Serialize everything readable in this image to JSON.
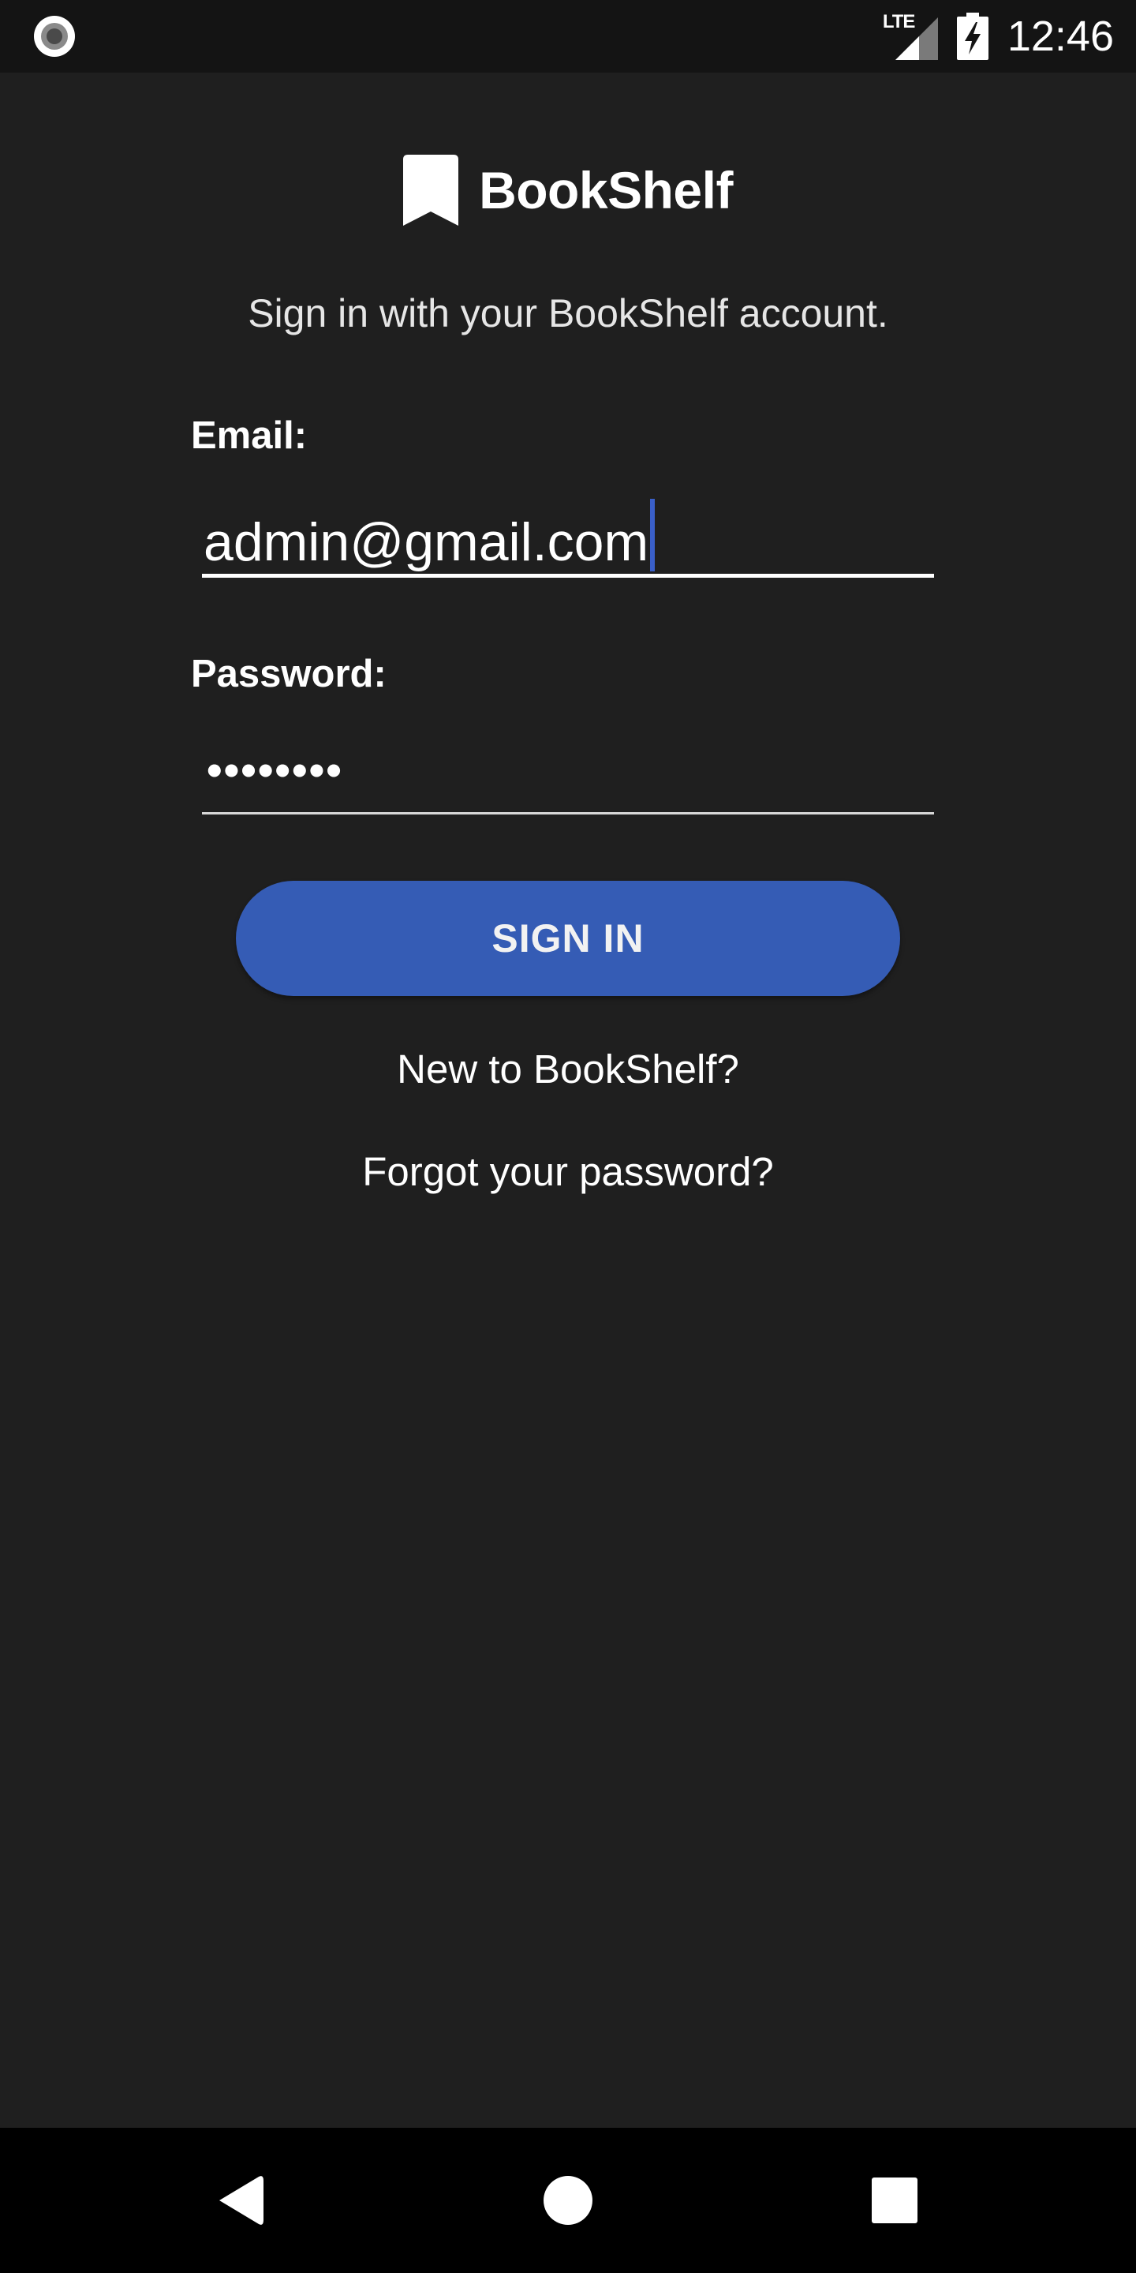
{
  "status_bar": {
    "network_label": "LTE",
    "time": "12:46"
  },
  "brand": {
    "name": "BookShelf",
    "icon": "bookmark-icon"
  },
  "subtitle": "Sign in with your BookShelf account.",
  "form": {
    "email_label": "Email:",
    "email_value": "admin@gmail.com",
    "password_label": "Password:",
    "password_value": "••••••••",
    "sign_in_label": "SIGN IN"
  },
  "links": {
    "new_user": "New to BookShelf?",
    "forgot_password": "Forgot your password?"
  },
  "navigation": {
    "back_icon": "back-triangle-icon",
    "home_icon": "home-circle-icon",
    "recents_icon": "recents-square-icon"
  },
  "colors": {
    "background": "#1f1f1f",
    "accent": "#355cb5",
    "caret": "#3a5fc8"
  }
}
